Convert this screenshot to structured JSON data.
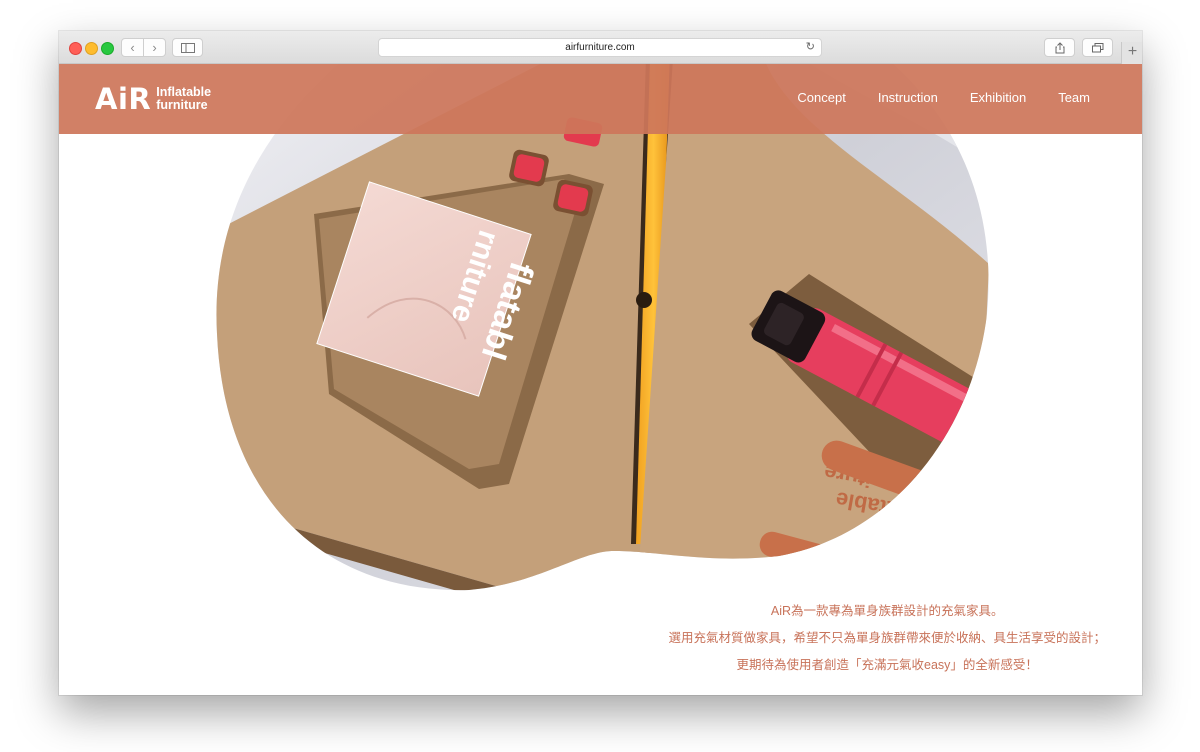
{
  "browser": {
    "url": "airfurniture.com"
  },
  "header": {
    "logo_mark": "AiR",
    "logo_line1": "Inflatable",
    "logo_line2": "furniture",
    "nav": [
      "Concept",
      "Instruction",
      "Exhibition",
      "Team"
    ]
  },
  "hero": {
    "box_print_1": "flatabl",
    "box_print_2": "rniture",
    "box_print_3": "flatable",
    "box_print_4": "urniture"
  },
  "intro": {
    "line1": "AiR為一款專為單身族群設計的充氣家具。",
    "line2": "選用充氣材質做家具，希望不只為單身族群帶來便於收納、具生活享受的設計；",
    "line3": "更期待為使用者創造「充滿元氣收easy」的全新感受！"
  },
  "colors": {
    "brand": "#cd765a",
    "text_accent": "#c8735a"
  }
}
